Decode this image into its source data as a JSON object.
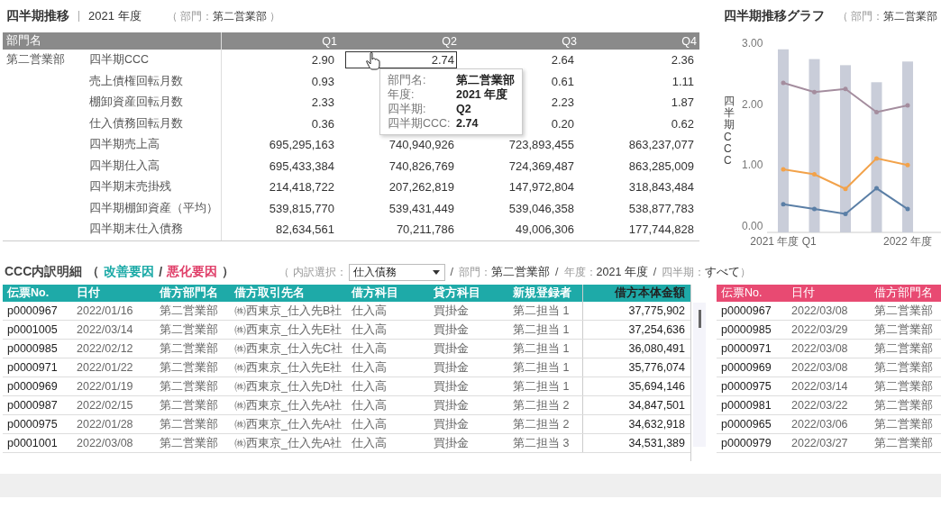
{
  "summary": {
    "title": "四半期推移",
    "year": "2021 年度",
    "dept_label": "（ 部門：",
    "dept_value": "第二営業部",
    "dept_close": "）",
    "department_header": "部門名",
    "columns": [
      "Q1",
      "Q2",
      "Q3",
      "Q4"
    ],
    "rows": [
      {
        "department": "第二営業部",
        "label": "四半期CCC",
        "cells": [
          {
            "text": "2.90",
            "selected": false
          },
          {
            "text": "2.74",
            "selected": true
          },
          {
            "text": "2.64",
            "selected": false
          },
          {
            "text": "2.36",
            "selected": false
          }
        ]
      },
      {
        "department": null,
        "label": "売上債権回転月数",
        "cells": [
          {
            "text": "0.93",
            "selected": false
          },
          {
            "text": null
          },
          {
            "text": "0.61",
            "selected": false
          },
          {
            "text": "1.11",
            "selected": false
          }
        ]
      },
      {
        "department": null,
        "label": "棚卸資産回転月数",
        "cells": [
          {
            "text": "2.33",
            "selected": false
          },
          {
            "text": null
          },
          {
            "text": "2.23",
            "selected": false
          },
          {
            "text": "1.87",
            "selected": false
          }
        ]
      },
      {
        "department": null,
        "label": "仕入債務回転月数",
        "cells": [
          {
            "text": "0.36",
            "selected": false
          },
          {
            "text": null
          },
          {
            "text": "0.20",
            "selected": false
          },
          {
            "text": "0.62",
            "selected": false
          }
        ]
      },
      {
        "department": null,
        "label": "四半期売上高",
        "cells": [
          {
            "text": "695,295,163",
            "selected": false
          },
          {
            "text": "740,940,926",
            "selected": false
          },
          {
            "text": "723,893,455",
            "selected": false
          },
          {
            "text": "863,237,077",
            "selected": false
          }
        ]
      },
      {
        "department": null,
        "label": "四半期仕入高",
        "cells": [
          {
            "text": "695,433,384",
            "selected": false
          },
          {
            "text": "740,826,769",
            "selected": false
          },
          {
            "text": "724,369,487",
            "selected": false
          },
          {
            "text": "863,285,009",
            "selected": false
          }
        ]
      },
      {
        "department": null,
        "label": "四半期末売掛残",
        "cells": [
          {
            "text": "214,418,722",
            "selected": false
          },
          {
            "text": "207,262,819",
            "selected": false
          },
          {
            "text": "147,972,804",
            "selected": false
          },
          {
            "text": "318,843,484",
            "selected": false
          }
        ]
      },
      {
        "department": null,
        "label": "四半期棚卸資産（平均）",
        "cells": [
          {
            "text": "539,815,770",
            "selected": false
          },
          {
            "text": "539,431,449",
            "selected": false
          },
          {
            "text": "539,046,358",
            "selected": false
          },
          {
            "text": "538,877,783",
            "selected": false
          }
        ]
      },
      {
        "department": null,
        "label": "四半期末仕入債務",
        "cells": [
          {
            "text": "82,634,561",
            "selected": false
          },
          {
            "text": "70,211,786",
            "selected": false
          },
          {
            "text": "49,006,306",
            "selected": false
          },
          {
            "text": "177,744,828",
            "selected": false
          }
        ]
      }
    ],
    "tooltip": [
      {
        "label": "部門名:",
        "value": "第二営業部"
      },
      {
        "label": "年度:",
        "value": "2021 年度"
      },
      {
        "label": "四半期:",
        "value": "Q2"
      },
      {
        "label": "四半期CCC:",
        "value": "2.74"
      }
    ]
  },
  "chart": {
    "title": "四半期推移グラフ",
    "dept_label": "（ 部門：",
    "dept_value": "第二営業部",
    "chart_data": {
      "type": "bar",
      "ylabel": "四半期CCC",
      "categories": [
        "2021 年度 Q1",
        null,
        null,
        null,
        "2022 年度"
      ],
      "ylim": [
        0,
        3
      ],
      "yticks": [
        {
          "value": 0,
          "label": "0.00"
        },
        {
          "value": 1,
          "label": "1.00"
        },
        {
          "value": 2,
          "label": "2.00"
        },
        {
          "value": 3,
          "label": "3.00"
        }
      ],
      "series": [
        {
          "type": "bar",
          "color": "#c9cdd9",
          "values": [
            2.9,
            2.74,
            2.64,
            2.36,
            2.7
          ]
        },
        {
          "type": "line",
          "color": "#a48d9e",
          "values": [
            2.35,
            2.2,
            2.25,
            1.87,
            1.98
          ]
        },
        {
          "type": "line",
          "color": "#f2a24a",
          "values": [
            0.93,
            0.85,
            0.61,
            1.11,
            1.0
          ]
        },
        {
          "type": "line",
          "color": "#5b7fa6",
          "values": [
            0.36,
            0.28,
            0.2,
            0.62,
            0.28
          ]
        }
      ]
    }
  },
  "detail": {
    "title": "CCC内訳明細",
    "paren_open": "（",
    "improve": "改善要因",
    "slash": "/",
    "worsen": "悪化要因",
    "paren_close": "）",
    "filter_open": "（ 内訳選択：",
    "filter_value": "仕入債務",
    "crumb_separator": "/",
    "crumbs": [
      {
        "label": "部門：",
        "value": "第二営業部"
      },
      {
        "label": "年度：",
        "value": "2021 年度"
      },
      {
        "label": "四半期：",
        "value": "すべて"
      }
    ],
    "filter_close": "）",
    "improve_table": {
      "columns": [
        "伝票No.",
        "日付",
        "借方部門名",
        "借方取引先名",
        "借方科目",
        "貸方科目",
        "新規登録者",
        "借方本体金額"
      ],
      "rows": [
        [
          "p0000967",
          "2022/01/16",
          "第二営業部",
          "㈱西東京_仕入先B社",
          "仕入高",
          "買掛金",
          "第二担当 1",
          "37,775,902"
        ],
        [
          "p0001005",
          "2022/03/14",
          "第二営業部",
          "㈱西東京_仕入先E社",
          "仕入高",
          "買掛金",
          "第二担当 1",
          "37,254,636"
        ],
        [
          "p0000985",
          "2022/02/12",
          "第二営業部",
          "㈱西東京_仕入先C社",
          "仕入高",
          "買掛金",
          "第二担当 1",
          "36,080,491"
        ],
        [
          "p0000971",
          "2022/01/22",
          "第二営業部",
          "㈱西東京_仕入先E社",
          "仕入高",
          "買掛金",
          "第二担当 1",
          "35,776,074"
        ],
        [
          "p0000969",
          "2022/01/19",
          "第二営業部",
          "㈱西東京_仕入先D社",
          "仕入高",
          "買掛金",
          "第二担当 1",
          "35,694,146"
        ],
        [
          "p0000987",
          "2022/02/15",
          "第二営業部",
          "㈱西東京_仕入先A社",
          "仕入高",
          "買掛金",
          "第二担当 2",
          "34,847,501"
        ],
        [
          "p0000975",
          "2022/01/28",
          "第二営業部",
          "㈱西東京_仕入先A社",
          "仕入高",
          "買掛金",
          "第二担当 2",
          "34,632,918"
        ],
        [
          "p0001001",
          "2022/03/08",
          "第二営業部",
          "㈱西東京_仕入先A社",
          "仕入高",
          "買掛金",
          "第二担当 3",
          "34,531,389"
        ]
      ]
    },
    "worsen_table": {
      "columns": [
        "伝票No.",
        "日付",
        "借方部門名"
      ],
      "rows": [
        [
          "p0000967",
          "2022/03/08",
          "第二営業部"
        ],
        [
          "p0000985",
          "2022/03/29",
          "第二営業部"
        ],
        [
          "p0000971",
          "2022/03/08",
          "第二営業部"
        ],
        [
          "p0000969",
          "2022/03/08",
          "第二営業部"
        ],
        [
          "p0000975",
          "2022/03/14",
          "第二営業部"
        ],
        [
          "p0000981",
          "2022/03/22",
          "第二営業部"
        ],
        [
          "p0000965",
          "2022/03/06",
          "第二営業部"
        ],
        [
          "p0000979",
          "2022/03/27",
          "第二営業部"
        ]
      ]
    }
  }
}
